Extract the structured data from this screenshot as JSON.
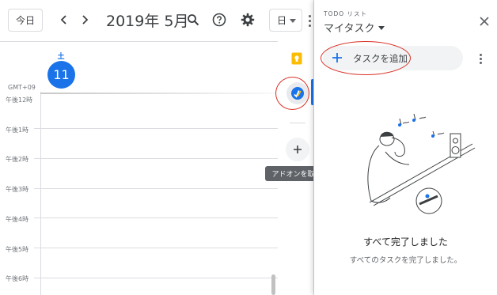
{
  "header": {
    "today_label": "今日",
    "month_title": "2019年 5月",
    "view_select": "日"
  },
  "day_column": {
    "weekday": "土",
    "date": "11",
    "timezone": "GMT+09"
  },
  "hours": [
    "午後12時",
    "午後1時",
    "午後2時",
    "午後3時",
    "午後4時",
    "午後5時",
    "午後6時"
  ],
  "side_strip": {
    "addons_label": "アドオンを取得"
  },
  "tasks_panel": {
    "eyebrow": "TODO リスト",
    "title": "マイタスク",
    "add_task_label": "タスクを追加",
    "empty_title": "すべて完了しました",
    "empty_subtitle": "すべてのタスクを完了しました。"
  },
  "colors": {
    "accent": "#1a73e8",
    "annotation": "#d93025"
  },
  "icons": {
    "header": [
      "chevron-left-icon",
      "chevron-right-icon",
      "search-icon",
      "help-icon",
      "gear-icon",
      "more-vert-icon"
    ],
    "strip": [
      "keep-icon",
      "tasks-icon",
      "add-icon"
    ],
    "panel": [
      "close-icon",
      "plus-icon",
      "more-vert-icon"
    ]
  }
}
